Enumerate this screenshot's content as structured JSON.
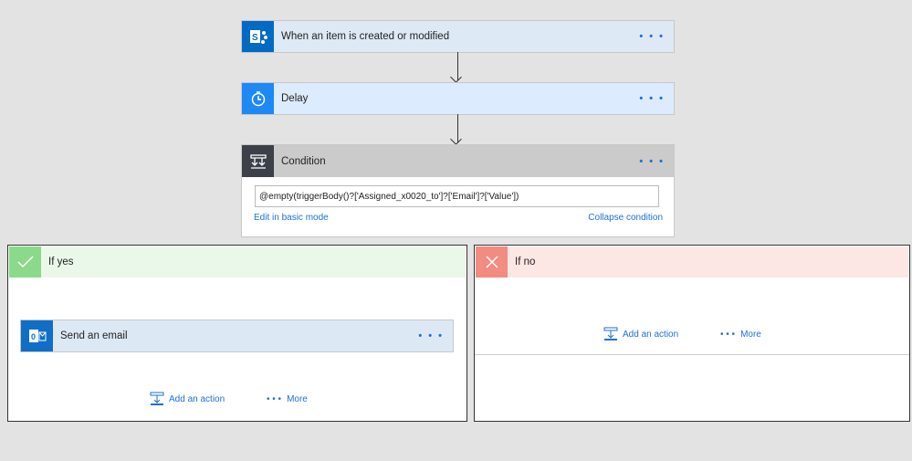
{
  "trigger": {
    "title": "When an item is created or modified",
    "icon": "sharepoint-icon",
    "color": "#036ac4"
  },
  "delay": {
    "title": "Delay",
    "icon": "timer-icon",
    "color": "#1e88f5"
  },
  "condition": {
    "title": "Condition",
    "icon": "condition-icon",
    "expression": "@empty(triggerBody()?['Assigned_x0020_to']?['Email']?['Value'])",
    "edit_link": "Edit in basic mode",
    "collapse_link": "Collapse condition"
  },
  "more_dots": "• • •",
  "if_yes": {
    "title": "If yes",
    "color": "#8bd98b",
    "action": {
      "title": "Send an email",
      "icon": "outlook-icon"
    },
    "add_action": "Add an action",
    "more": "More"
  },
  "if_no": {
    "title": "If no",
    "color": "#f28b82",
    "add_action": "Add an action",
    "more": "More"
  }
}
